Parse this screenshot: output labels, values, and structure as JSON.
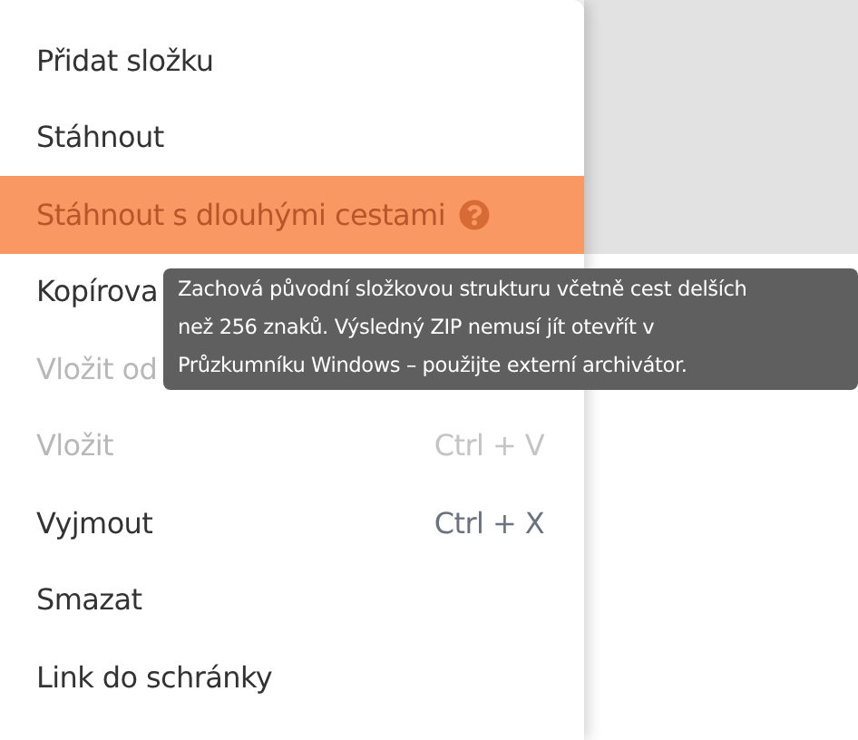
{
  "menu": {
    "items": [
      {
        "label": "Přidat složku",
        "disabled": false,
        "selected": false
      },
      {
        "label": "Stáhnout",
        "disabled": false,
        "selected": false
      },
      {
        "label": "Stáhnout s dlouhými cestami",
        "disabled": false,
        "selected": true,
        "help": true
      },
      {
        "label": "Kopírova",
        "disabled": false,
        "selected": false
      },
      {
        "label": "Vložit od",
        "disabled": true,
        "selected": false
      },
      {
        "label": "Vložit",
        "shortcut": "Ctrl + V",
        "disabled": true,
        "selected": false
      },
      {
        "label": "Vyjmout",
        "shortcut": "Ctrl + X",
        "disabled": false,
        "selected": false
      },
      {
        "label": "Smazat",
        "disabled": false,
        "selected": false
      },
      {
        "label": "Link do schránky",
        "disabled": false,
        "selected": false
      }
    ]
  },
  "tooltip": {
    "text": "Zachová původní složkovou strukturu včetně cest delších než 256 znaků. Výsledný ZIP nemusí jít otevřít v Průzkumníku Windows – použijte externí archivátor."
  }
}
